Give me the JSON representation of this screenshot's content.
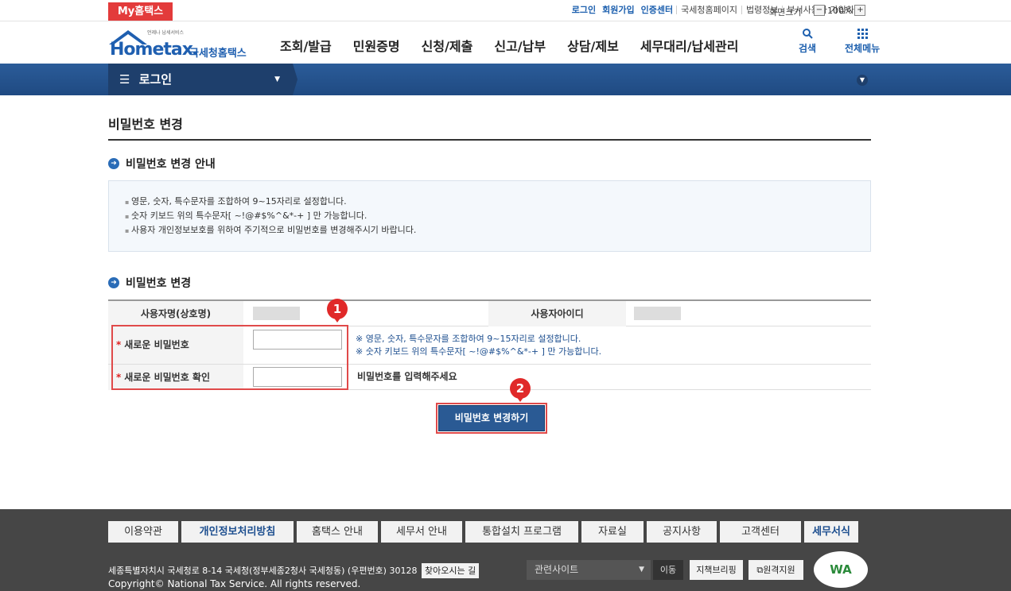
{
  "topbar": {
    "my_tab": "My홈택스",
    "links": [
      "로그인",
      "회원가입",
      "인증센터",
      "국세청홈페이지",
      "법령정보",
      "부서사용자 가입하기"
    ],
    "zoom_label": "화면크기",
    "zoom_value": "100%",
    "zoom_minus": "−",
    "zoom_plus": "+"
  },
  "header": {
    "logo_tagline": "언제나 납세서비스",
    "logo_text": "Hometax.",
    "logo_kr": "국세청홈택스",
    "nav": [
      "조회/발급",
      "민원증명",
      "신청/제출",
      "신고/납부",
      "상담/제보",
      "세무대리/납세관리"
    ],
    "search_label": "검색",
    "menu_label": "전체메뉴"
  },
  "breadcrumb": {
    "label": "로그인"
  },
  "page": {
    "title": "비밀번호 변경"
  },
  "guide": {
    "title": "비밀번호 변경 안내",
    "items": [
      "영문, 숫자, 특수문자를 조합하여 9~15자리로 설정합니다.",
      "숫자 키보드 위의 특수문자[ ~!@#$%^&*-+ ] 만 가능합니다.",
      "사용자 개인정보보호를 위하여 주기적으로 비밀번호를 변경해주시기 바랍니다."
    ]
  },
  "form": {
    "title": "비밀번호 변경",
    "user_name_label": "사용자명(상호명)",
    "user_id_label": "사용자아이디",
    "required_mark": "*",
    "new_pw_label": "새로운 비밀번호",
    "confirm_pw_label": "새로운 비밀번호 확인",
    "hint1": "※ 영문, 숫자, 특수문자를 조합하여 9~15자리로 설정합니다.",
    "hint2": "※ 숫자 키보드 위의 특수문자[ ~!@#$%^&*-+ ] 만 가능합니다.",
    "confirm_msg": "비밀번호를 입력해주세요",
    "submit": "비밀번호 변경하기",
    "badge1": "1",
    "badge2": "2"
  },
  "footer": {
    "nav": [
      "이용약관",
      "개인정보처리방침",
      "홈택스 안내",
      "세무서 안내",
      "통합설치 프로그램",
      "자료실",
      "공지사항",
      "고객센터",
      "세무서식"
    ],
    "address": "세종특별자치시 국세청로 8-14 국세청(정부세종2청사 국세청동) (우편번호) 30128",
    "directions": "찾아오시는 길",
    "copyright": "Copyright© National Tax Service. All rights reserved.",
    "related_sites": "관련사이트",
    "go": "이동",
    "btn1": "지책브리핑",
    "btn2": "원격지원",
    "wa_mark": "WA"
  }
}
